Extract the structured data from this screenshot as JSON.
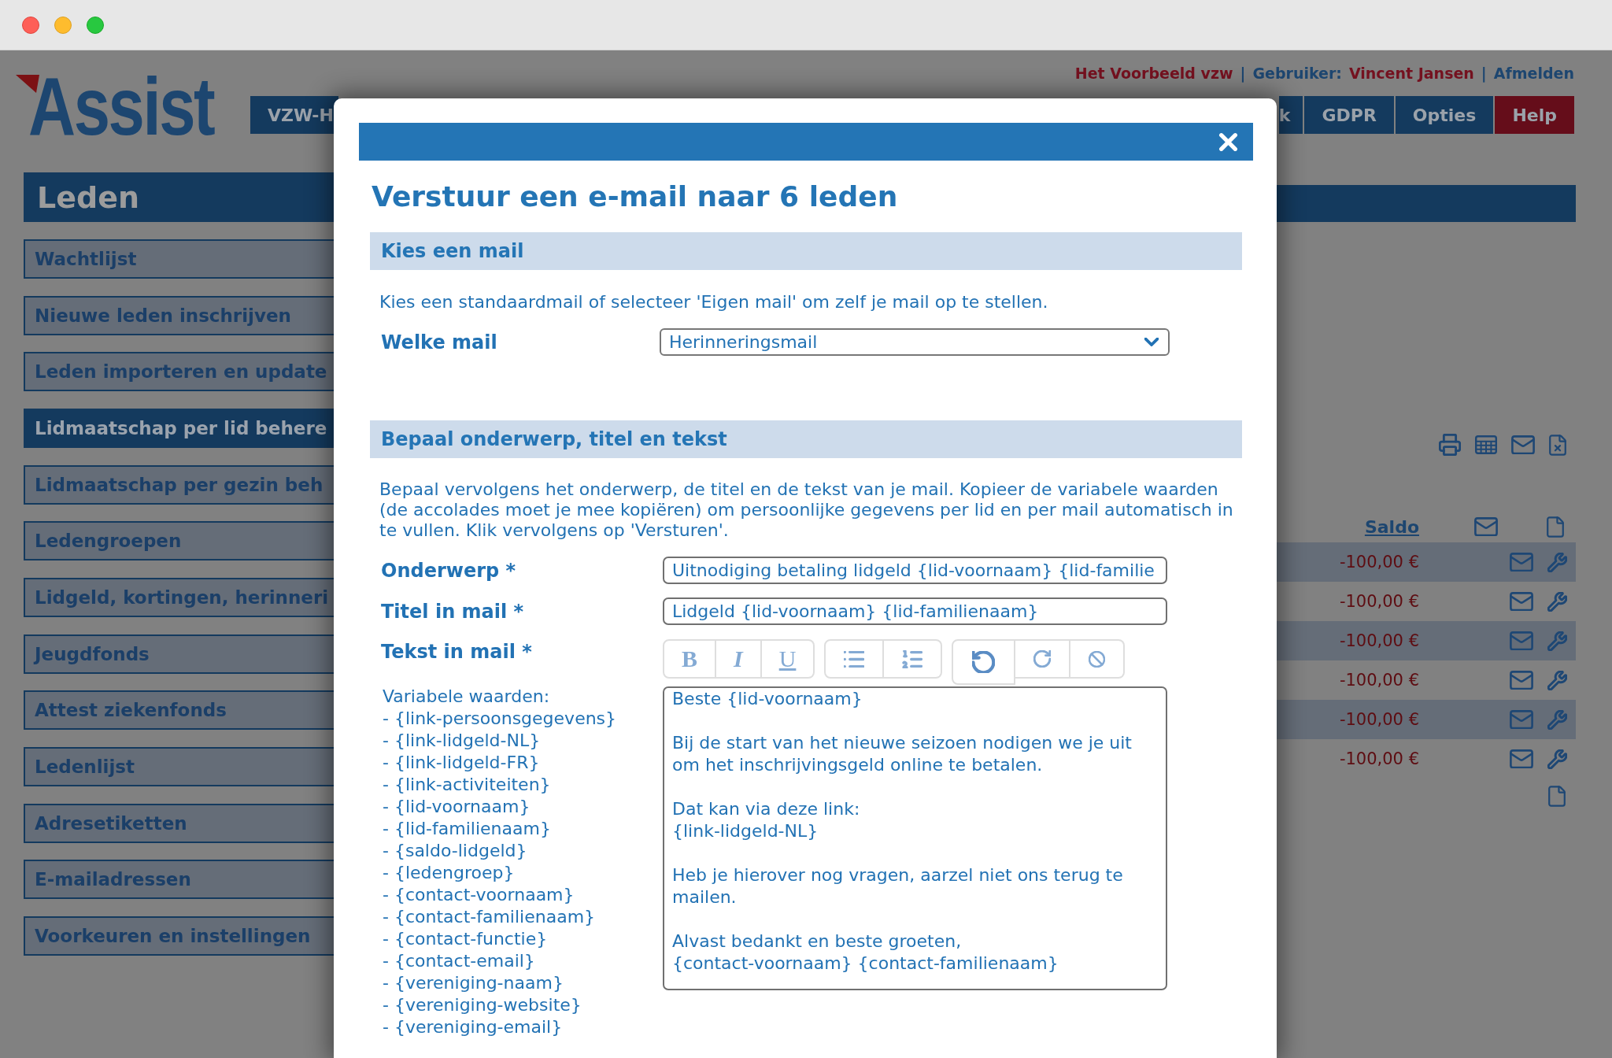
{
  "header": {
    "logo": "Assist",
    "user_bar": [
      {
        "kind": "organization",
        "text": "Het Voorbeeld vzw"
      },
      {
        "kind": "separator",
        "text": "|"
      },
      {
        "kind": "label",
        "text": "Gebruiker:"
      },
      {
        "kind": "user",
        "text": "Vincent Jansen"
      },
      {
        "kind": "separator",
        "text": "|"
      },
      {
        "kind": "link",
        "text": "Afmelden"
      }
    ],
    "nav": {
      "start": [
        {
          "label": "VZW-H",
          "color": "#143a5e"
        }
      ],
      "end": [
        {
          "label": "k",
          "color": "#143a5e"
        },
        {
          "label": "GDPR",
          "color": "#143a5e"
        },
        {
          "label": "Opties",
          "color": "#143a5e"
        },
        {
          "label": "Help",
          "color": "#650d1a"
        }
      ]
    }
  },
  "sidebar": {
    "title": "Leden",
    "items": [
      {
        "label": "Wachtlijst",
        "selected": false
      },
      {
        "label": "Nieuwe leden inschrijven",
        "selected": false
      },
      {
        "label": "Leden importeren en update",
        "selected": false
      },
      {
        "label": "Lidmaatschap per lid behere",
        "selected": true
      },
      {
        "label": "Lidmaatschap per gezin beh",
        "selected": false
      },
      {
        "label": "Ledengroepen",
        "selected": false
      },
      {
        "label": "Lidgeld, kortingen, herinneri",
        "selected": false
      },
      {
        "label": "Jeugdfonds",
        "selected": false
      },
      {
        "label": "Attest ziekenfonds",
        "selected": false
      },
      {
        "label": "Ledenlijst",
        "selected": false
      },
      {
        "label": "Adresetiketten",
        "selected": false
      },
      {
        "label": "E-mailadressen",
        "selected": false
      },
      {
        "label": "Voorkeuren en instellingen",
        "selected": false
      }
    ]
  },
  "content": {
    "table": {
      "columns": [
        {
          "label": "Saldo"
        }
      ],
      "rows": [
        {
          "saldo": "-100,00 €"
        },
        {
          "saldo": "-100,00 €"
        },
        {
          "saldo": "-100,00 €"
        },
        {
          "saldo": "-100,00 €"
        },
        {
          "saldo": "-100,00 €"
        },
        {
          "saldo": "-100,00 €"
        }
      ]
    }
  },
  "modal": {
    "title": "Verstuur een e-mail naar 6 leden",
    "choose": {
      "heading": "Kies een mail",
      "intro": "Kies een standaardmail of selecteer 'Eigen mail' om zelf je mail op te stellen.",
      "label": "Welke mail",
      "value": "Herinneringsmail"
    },
    "compose": {
      "heading": "Bepaal onderwerp, titel en tekst",
      "intro": "Bepaal vervolgens het onderwerp, de titel en de tekst van je mail. Kopieer de variabele waarden (de accolades moet je mee kopiëren) om persoonlijke gegevens per lid en per mail automatisch in te vullen. Klik vervolgens op 'Versturen'.",
      "fields": [
        {
          "label": "Onderwerp *",
          "value": "Uitnodiging betaling lidgeld {lid-voornaam} {lid-familie"
        },
        {
          "label": "Titel in mail *",
          "value": "Lidgeld {lid-voornaam} {lid-familienaam}"
        }
      ],
      "body": {
        "label": "Tekst in mail *",
        "toolbar": [
          [
            {
              "kind": "bold",
              "label": "B",
              "active": false
            },
            {
              "kind": "italic",
              "label": "I",
              "active": false
            },
            {
              "kind": "underline",
              "label": "U",
              "active": false
            }
          ],
          [
            {
              "kind": "bullet-list",
              "active": false
            },
            {
              "kind": "numbered-list",
              "active": false
            }
          ],
          [
            {
              "kind": "undo",
              "active": true
            },
            {
              "kind": "redo",
              "active": false
            },
            {
              "kind": "clear",
              "active": false
            }
          ]
        ],
        "paragraphs": [
          [
            "Beste {lid-voornaam}"
          ],
          [
            "Bij de start van het nieuwe seizoen nodigen we je uit om het inschrijvingsgeld online te betalen."
          ],
          [
            "Dat kan via deze link:",
            "{link-lidgeld-NL}"
          ],
          [
            "Heb je hierover nog vragen, aarzel niet ons terug te mailen."
          ],
          [
            "Alvast bedankt en beste groeten,",
            "{contact-voornaam} {contact-familienaam}"
          ]
        ]
      },
      "variables": {
        "heading": "Variabele waarden:",
        "items": [
          "- {link-persoonsgegevens}",
          "- {link-lidgeld-NL}",
          "- {link-lidgeld-FR}",
          "- {link-activiteiten}",
          "- {lid-voornaam}",
          "- {lid-familienaam}",
          "- {saldo-lidgeld}",
          "- {ledengroep}",
          "- {contact-voornaam}",
          "- {contact-familienaam}",
          "- {contact-functie}",
          "- {contact-email}",
          "- {vereniging-naam}",
          "- {vereniging-website}",
          "- {vereniging-email}"
        ]
      }
    }
  }
}
